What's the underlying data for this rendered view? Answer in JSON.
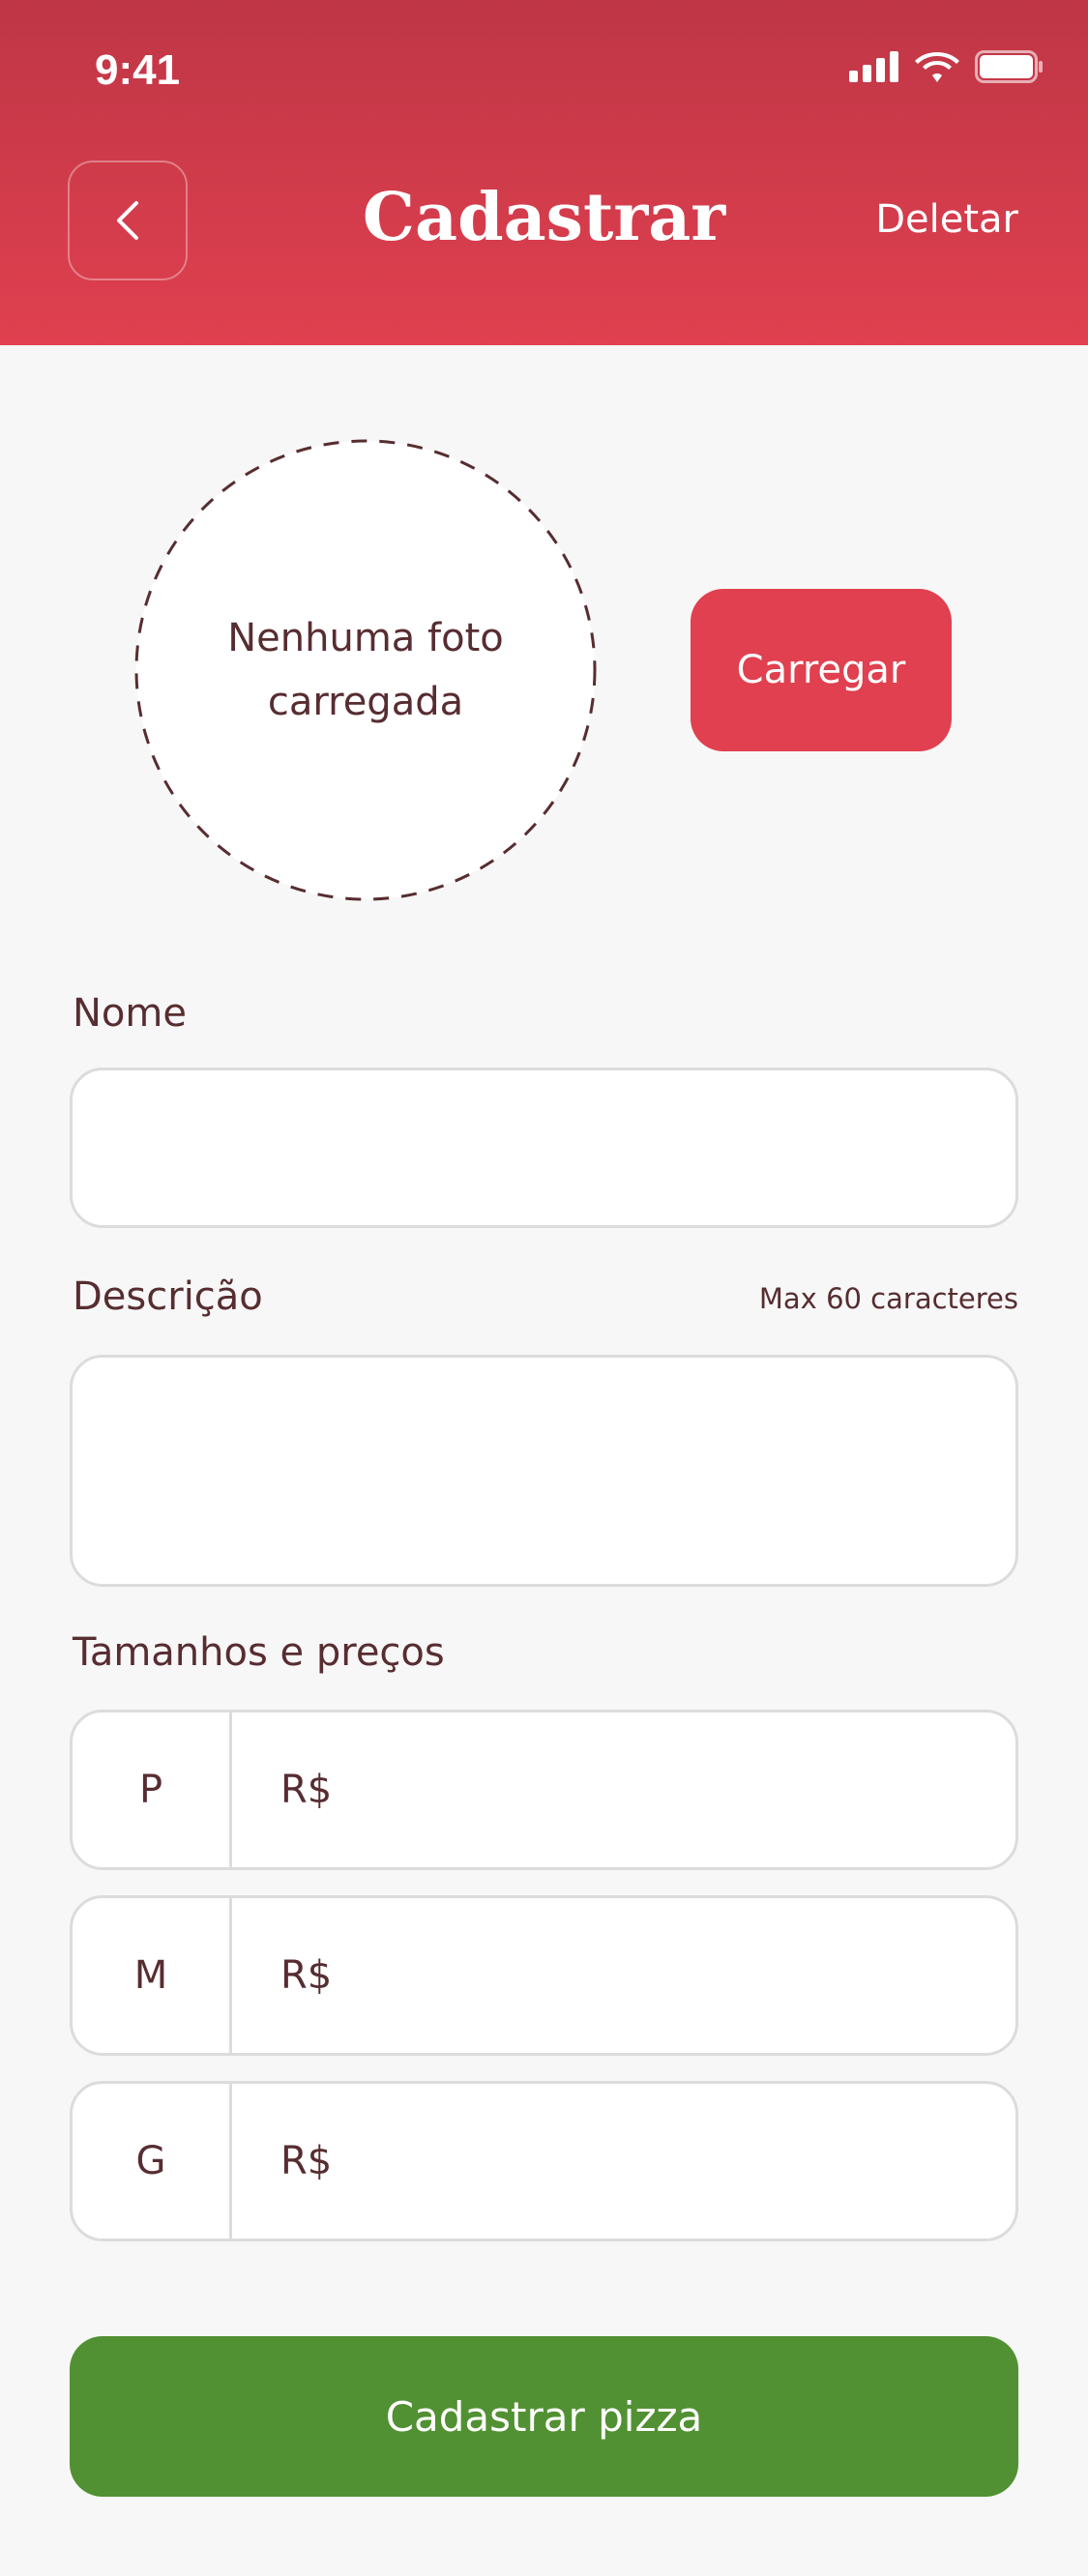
{
  "status_bar": {
    "time": "9:41"
  },
  "header": {
    "title": "Cadastrar",
    "delete_label": "Deletar"
  },
  "photo": {
    "placeholder": "Nenhuma foto carregada",
    "upload_label": "Carregar"
  },
  "form": {
    "name_label": "Nome",
    "name_value": "",
    "description_label": "Descrição",
    "description_hint": "Max 60 caracteres",
    "description_value": "",
    "sizes_label": "Tamanhos e preços",
    "sizes": [
      {
        "size": "P",
        "currency": "R$",
        "value": ""
      },
      {
        "size": "M",
        "currency": "R$",
        "value": ""
      },
      {
        "size": "G",
        "currency": "R$",
        "value": ""
      }
    ]
  },
  "submit_label": "Cadastrar pizza",
  "colors": {
    "primary": "#E0404F",
    "success": "#529133",
    "text": "#572D31",
    "background": "#F7F7F7"
  }
}
